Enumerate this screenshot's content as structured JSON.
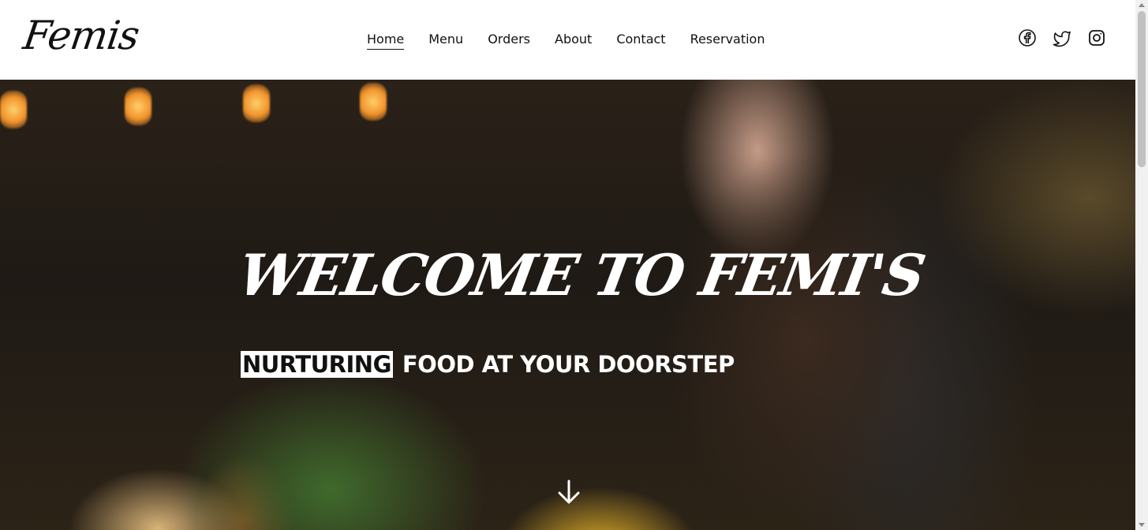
{
  "header": {
    "logo": "Femis",
    "nav": [
      {
        "label": "Home",
        "active": true
      },
      {
        "label": "Menu",
        "active": false
      },
      {
        "label": "Orders",
        "active": false
      },
      {
        "label": "About",
        "active": false
      },
      {
        "label": "Contact",
        "active": false
      },
      {
        "label": "Reservation",
        "active": false
      }
    ],
    "socials": [
      "facebook-icon",
      "twitter-icon",
      "instagram-icon"
    ]
  },
  "hero": {
    "title": "WELCOME TO FEMI'S",
    "tagline_highlight": "NURTURING",
    "tagline_rest": "FOOD AT YOUR DOORSTEP",
    "scroll_icon": "arrow-down-icon"
  },
  "colors": {
    "text_dark": "#111111",
    "hero_text": "#ffffff",
    "accent_yellow": "#e7b42a"
  }
}
